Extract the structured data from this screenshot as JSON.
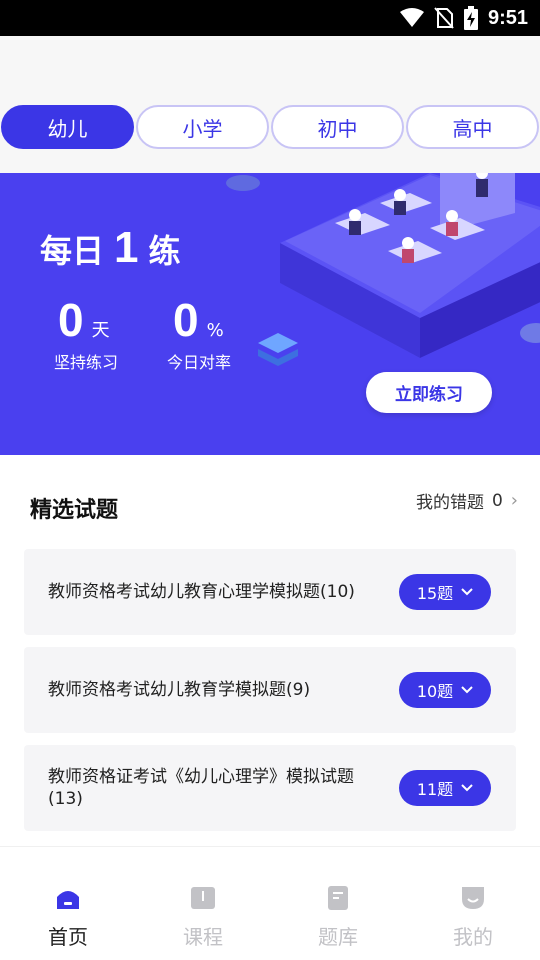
{
  "status_bar": {
    "time": "9:51"
  },
  "level_tabs": [
    {
      "label": "幼儿",
      "active": true
    },
    {
      "label": "小学",
      "active": false
    },
    {
      "label": "初中",
      "active": false
    },
    {
      "label": "高中",
      "active": false
    }
  ],
  "banner": {
    "title_prefix": "每日",
    "title_number": "1",
    "title_suffix": "练",
    "streak_value": "0",
    "streak_unit": "天",
    "streak_label": "坚持练习",
    "rate_value": "0",
    "rate_unit": "%",
    "rate_label": "今日对率",
    "practice_button": "立即练习"
  },
  "featured": {
    "title": "精选试题",
    "wrong_link_label": "我的错题",
    "wrong_count": "0"
  },
  "questions": [
    {
      "title": "教师资格考试幼儿教育心理学模拟题(10)",
      "count_label": "15题"
    },
    {
      "title": "教师资格考试幼儿教育学模拟题(9)",
      "count_label": "10题"
    },
    {
      "title": "教师资格证考试《幼儿心理学》模拟试题(13)",
      "count_label": "11题"
    }
  ],
  "bottom_nav": [
    {
      "label": "首页",
      "icon": "home-icon",
      "active": true
    },
    {
      "label": "课程",
      "icon": "book-icon",
      "active": false
    },
    {
      "label": "题库",
      "icon": "question-bank-icon",
      "active": false
    },
    {
      "label": "我的",
      "icon": "profile-icon",
      "active": false
    }
  ],
  "colors": {
    "accent": "#3b36e6",
    "banner": "#4a40ef",
    "tab_border": "#c8c4f5",
    "inactive_nav": "#c2c2c6"
  }
}
